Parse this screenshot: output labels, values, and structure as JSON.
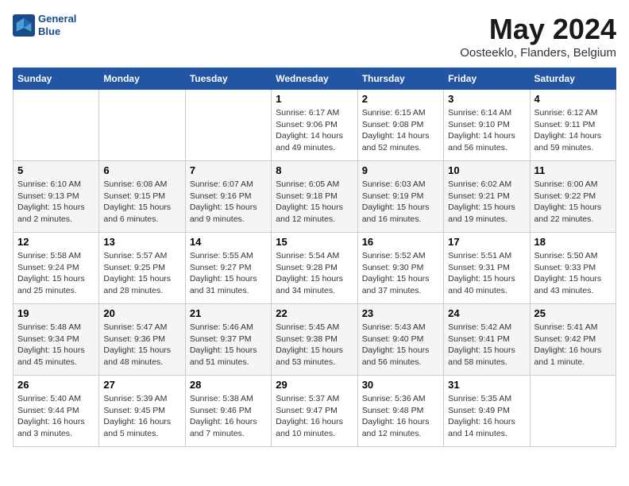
{
  "header": {
    "logo_line1": "General",
    "logo_line2": "Blue",
    "month": "May 2024",
    "location": "Oosteeklo, Flanders, Belgium"
  },
  "days_of_week": [
    "Sunday",
    "Monday",
    "Tuesday",
    "Wednesday",
    "Thursday",
    "Friday",
    "Saturday"
  ],
  "weeks": [
    [
      {
        "num": "",
        "sunrise": "",
        "sunset": "",
        "daylight": ""
      },
      {
        "num": "",
        "sunrise": "",
        "sunset": "",
        "daylight": ""
      },
      {
        "num": "",
        "sunrise": "",
        "sunset": "",
        "daylight": ""
      },
      {
        "num": "1",
        "sunrise": "Sunrise: 6:17 AM",
        "sunset": "Sunset: 9:06 PM",
        "daylight": "Daylight: 14 hours and 49 minutes."
      },
      {
        "num": "2",
        "sunrise": "Sunrise: 6:15 AM",
        "sunset": "Sunset: 9:08 PM",
        "daylight": "Daylight: 14 hours and 52 minutes."
      },
      {
        "num": "3",
        "sunrise": "Sunrise: 6:14 AM",
        "sunset": "Sunset: 9:10 PM",
        "daylight": "Daylight: 14 hours and 56 minutes."
      },
      {
        "num": "4",
        "sunrise": "Sunrise: 6:12 AM",
        "sunset": "Sunset: 9:11 PM",
        "daylight": "Daylight: 14 hours and 59 minutes."
      }
    ],
    [
      {
        "num": "5",
        "sunrise": "Sunrise: 6:10 AM",
        "sunset": "Sunset: 9:13 PM",
        "daylight": "Daylight: 15 hours and 2 minutes."
      },
      {
        "num": "6",
        "sunrise": "Sunrise: 6:08 AM",
        "sunset": "Sunset: 9:15 PM",
        "daylight": "Daylight: 15 hours and 6 minutes."
      },
      {
        "num": "7",
        "sunrise": "Sunrise: 6:07 AM",
        "sunset": "Sunset: 9:16 PM",
        "daylight": "Daylight: 15 hours and 9 minutes."
      },
      {
        "num": "8",
        "sunrise": "Sunrise: 6:05 AM",
        "sunset": "Sunset: 9:18 PM",
        "daylight": "Daylight: 15 hours and 12 minutes."
      },
      {
        "num": "9",
        "sunrise": "Sunrise: 6:03 AM",
        "sunset": "Sunset: 9:19 PM",
        "daylight": "Daylight: 15 hours and 16 minutes."
      },
      {
        "num": "10",
        "sunrise": "Sunrise: 6:02 AM",
        "sunset": "Sunset: 9:21 PM",
        "daylight": "Daylight: 15 hours and 19 minutes."
      },
      {
        "num": "11",
        "sunrise": "Sunrise: 6:00 AM",
        "sunset": "Sunset: 9:22 PM",
        "daylight": "Daylight: 15 hours and 22 minutes."
      }
    ],
    [
      {
        "num": "12",
        "sunrise": "Sunrise: 5:58 AM",
        "sunset": "Sunset: 9:24 PM",
        "daylight": "Daylight: 15 hours and 25 minutes."
      },
      {
        "num": "13",
        "sunrise": "Sunrise: 5:57 AM",
        "sunset": "Sunset: 9:25 PM",
        "daylight": "Daylight: 15 hours and 28 minutes."
      },
      {
        "num": "14",
        "sunrise": "Sunrise: 5:55 AM",
        "sunset": "Sunset: 9:27 PM",
        "daylight": "Daylight: 15 hours and 31 minutes."
      },
      {
        "num": "15",
        "sunrise": "Sunrise: 5:54 AM",
        "sunset": "Sunset: 9:28 PM",
        "daylight": "Daylight: 15 hours and 34 minutes."
      },
      {
        "num": "16",
        "sunrise": "Sunrise: 5:52 AM",
        "sunset": "Sunset: 9:30 PM",
        "daylight": "Daylight: 15 hours and 37 minutes."
      },
      {
        "num": "17",
        "sunrise": "Sunrise: 5:51 AM",
        "sunset": "Sunset: 9:31 PM",
        "daylight": "Daylight: 15 hours and 40 minutes."
      },
      {
        "num": "18",
        "sunrise": "Sunrise: 5:50 AM",
        "sunset": "Sunset: 9:33 PM",
        "daylight": "Daylight: 15 hours and 43 minutes."
      }
    ],
    [
      {
        "num": "19",
        "sunrise": "Sunrise: 5:48 AM",
        "sunset": "Sunset: 9:34 PM",
        "daylight": "Daylight: 15 hours and 45 minutes."
      },
      {
        "num": "20",
        "sunrise": "Sunrise: 5:47 AM",
        "sunset": "Sunset: 9:36 PM",
        "daylight": "Daylight: 15 hours and 48 minutes."
      },
      {
        "num": "21",
        "sunrise": "Sunrise: 5:46 AM",
        "sunset": "Sunset: 9:37 PM",
        "daylight": "Daylight: 15 hours and 51 minutes."
      },
      {
        "num": "22",
        "sunrise": "Sunrise: 5:45 AM",
        "sunset": "Sunset: 9:38 PM",
        "daylight": "Daylight: 15 hours and 53 minutes."
      },
      {
        "num": "23",
        "sunrise": "Sunrise: 5:43 AM",
        "sunset": "Sunset: 9:40 PM",
        "daylight": "Daylight: 15 hours and 56 minutes."
      },
      {
        "num": "24",
        "sunrise": "Sunrise: 5:42 AM",
        "sunset": "Sunset: 9:41 PM",
        "daylight": "Daylight: 15 hours and 58 minutes."
      },
      {
        "num": "25",
        "sunrise": "Sunrise: 5:41 AM",
        "sunset": "Sunset: 9:42 PM",
        "daylight": "Daylight: 16 hours and 1 minute."
      }
    ],
    [
      {
        "num": "26",
        "sunrise": "Sunrise: 5:40 AM",
        "sunset": "Sunset: 9:44 PM",
        "daylight": "Daylight: 16 hours and 3 minutes."
      },
      {
        "num": "27",
        "sunrise": "Sunrise: 5:39 AM",
        "sunset": "Sunset: 9:45 PM",
        "daylight": "Daylight: 16 hours and 5 minutes."
      },
      {
        "num": "28",
        "sunrise": "Sunrise: 5:38 AM",
        "sunset": "Sunset: 9:46 PM",
        "daylight": "Daylight: 16 hours and 7 minutes."
      },
      {
        "num": "29",
        "sunrise": "Sunrise: 5:37 AM",
        "sunset": "Sunset: 9:47 PM",
        "daylight": "Daylight: 16 hours and 10 minutes."
      },
      {
        "num": "30",
        "sunrise": "Sunrise: 5:36 AM",
        "sunset": "Sunset: 9:48 PM",
        "daylight": "Daylight: 16 hours and 12 minutes."
      },
      {
        "num": "31",
        "sunrise": "Sunrise: 5:35 AM",
        "sunset": "Sunset: 9:49 PM",
        "daylight": "Daylight: 16 hours and 14 minutes."
      },
      {
        "num": "",
        "sunrise": "",
        "sunset": "",
        "daylight": ""
      }
    ]
  ]
}
